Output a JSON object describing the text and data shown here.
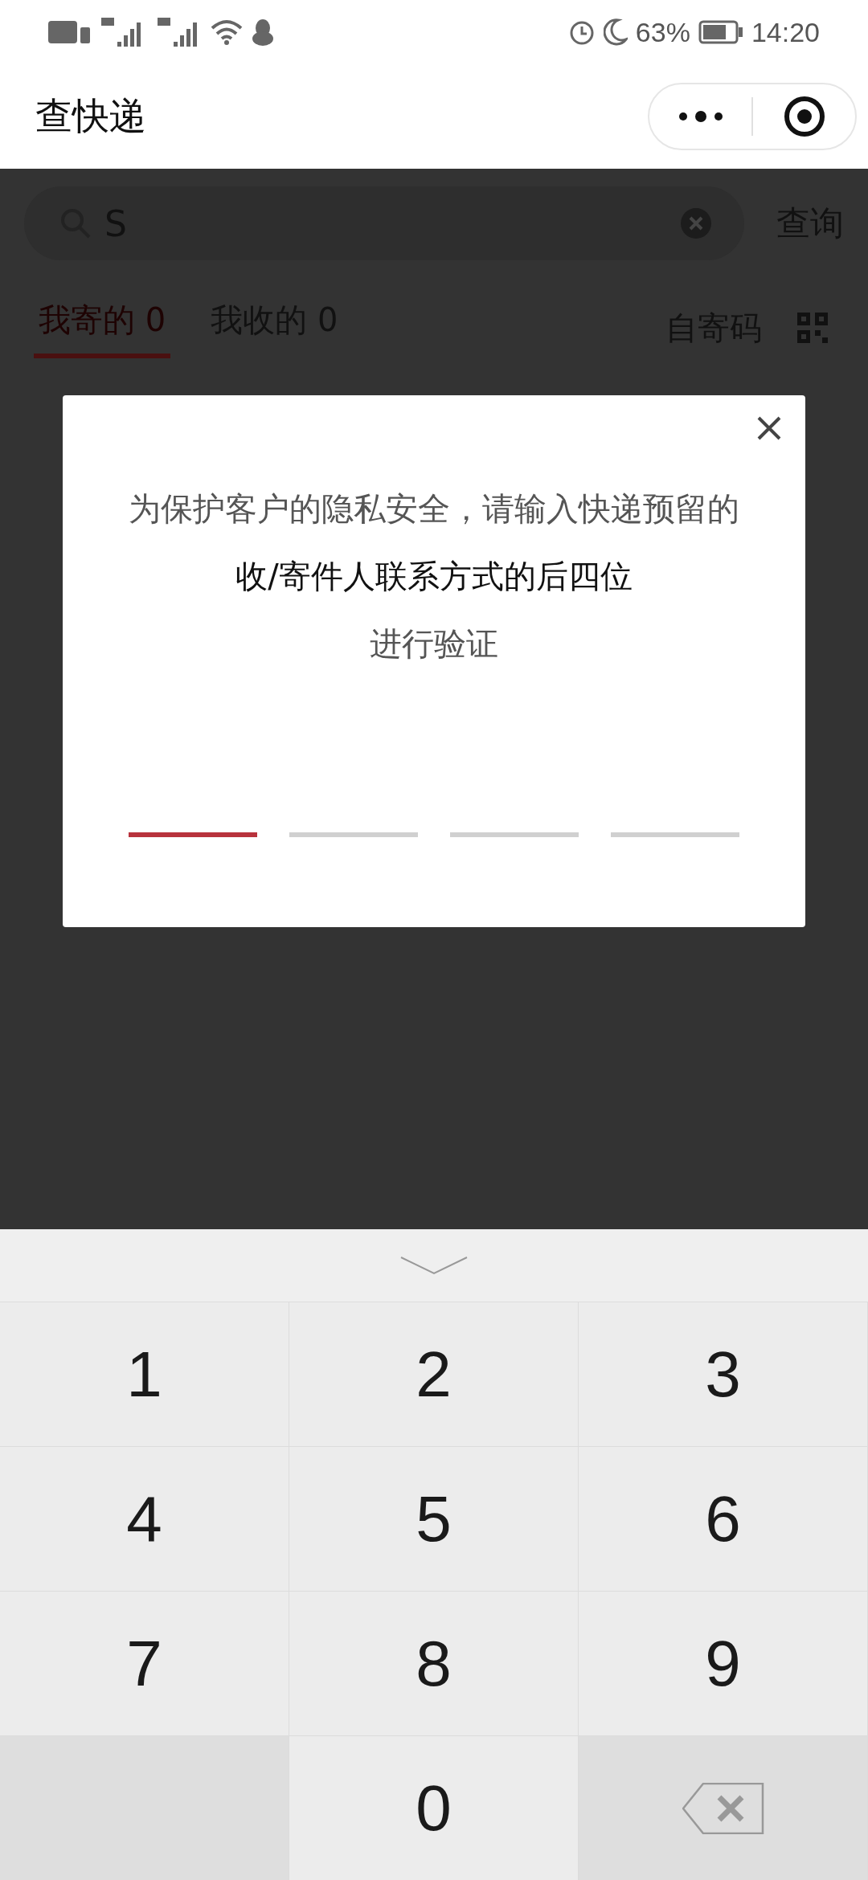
{
  "status_bar": {
    "battery": "63%",
    "time": "14:20"
  },
  "header": {
    "title": "查快递"
  },
  "search": {
    "value": "S",
    "button": "查询"
  },
  "tabs": [
    {
      "label": "我寄的 0",
      "selected": true
    },
    {
      "label": "我收的 0",
      "selected": false
    }
  ],
  "self_send_code": {
    "label": "自寄码"
  },
  "dialog": {
    "lines": [
      {
        "text": "为保护客户的隐私安全，请输入快递预留的",
        "emphasis": false
      },
      {
        "text": "收/寄件人联系方式的后四位",
        "emphasis": true
      },
      {
        "text": "进行验证",
        "emphasis": false
      }
    ],
    "code_slots": [
      {
        "selected": true
      },
      {
        "selected": false
      },
      {
        "selected": false
      },
      {
        "selected": false
      }
    ]
  },
  "keypad": {
    "keys": [
      {
        "kind": "digit",
        "label": "1"
      },
      {
        "kind": "digit",
        "label": "2"
      },
      {
        "kind": "digit",
        "label": "3"
      },
      {
        "kind": "digit",
        "label": "4"
      },
      {
        "kind": "digit",
        "label": "5"
      },
      {
        "kind": "digit",
        "label": "6"
      },
      {
        "kind": "digit",
        "label": "7"
      },
      {
        "kind": "digit",
        "label": "8"
      },
      {
        "kind": "digit",
        "label": "9"
      },
      {
        "kind": "blank"
      },
      {
        "kind": "digit",
        "label": "0"
      },
      {
        "kind": "backspace"
      }
    ]
  }
}
